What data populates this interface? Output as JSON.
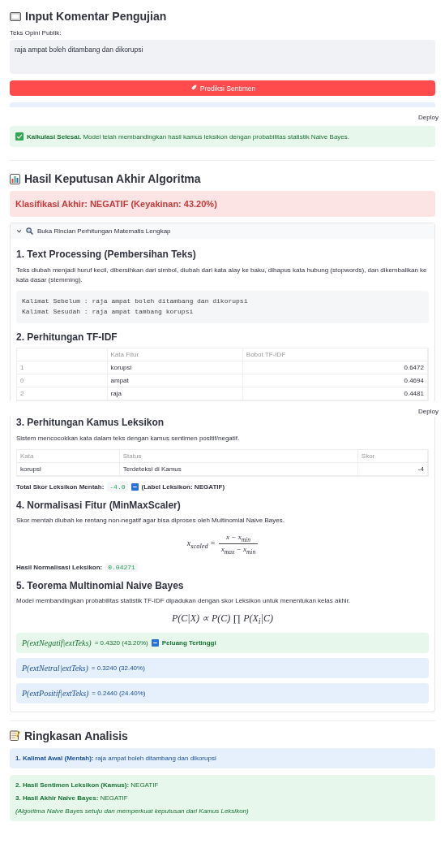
{
  "input_section": {
    "title": "Input Komentar Pengujian",
    "field_label": "Teks Opini Publik:",
    "value": "raja ampat boleh ditambang dan dikorupsi",
    "button": "Prediksi Sentimen"
  },
  "deploy": "Deploy",
  "success_message": "**Kalkulasi Selesai.** Model telah membandingkan hasil kamus leksikon dengan probabilitas statistik Naive Bayes.",
  "result": {
    "title": "Hasil Keputusan Akhir Algoritma",
    "classification": "Klasifikasi Akhir: NEGATIF (Keyakinan: 43.20%)"
  },
  "expander": {
    "label": "Buka Rincian Perhitungan Matematis Lengkap",
    "expanded": true,
    "text_processing": {
      "heading": "1. Text Processing (Pembersihan Teks)",
      "paragraph": "Teks diubah menjadi huruf kecil, dibersihkan dari simbol, diubah dari kata alay ke baku, dihapus kata hubung (stopwords), dan dikembalikan ke kata dasar (stemming).",
      "code_lines": [
        "Kalimat Sebelum : raja ampat boleh ditambang dan dikorupsi",
        "Kalimat Sesudah : raja ampat tambang korupsi"
      ]
    },
    "tfidf": {
      "heading": "2. Perhitungan TF-IDF",
      "columns": [
        "Kata Fitur",
        "Bobot TF-IDF"
      ],
      "rows": [
        {
          "index": "1",
          "word": "korupsi",
          "weight": "0.6472"
        },
        {
          "index": "0",
          "word": "ampat",
          "weight": "0.4694"
        },
        {
          "index": "2",
          "word": "raja",
          "weight": "0.4481"
        }
      ]
    },
    "deploy": "Deploy",
    "lexicon": {
      "heading": "3. Perhitungan Kamus Leksikon",
      "paragraph": "Sistem mencocokkan kata dalam teks dengan kamus sentimen positif/negatif.",
      "columns": [
        "Kata",
        "Status",
        "Skor"
      ],
      "rows": [
        {
          "word": "korupsi",
          "status": "Terdeteksi di Kamus",
          "score": "-4"
        }
      ],
      "total_label": "Total Skor Leksikon Mentah:",
      "total_value": "-4.0",
      "total_tail": "(Label Leksikon: NEGATIF)"
    },
    "normalization": {
      "heading": "4. Normalisasi Fitur (MinMaxScaler)",
      "paragraph": "Skor mentah diubah ke rentang non-negatif agar bisa diproses oleh Multinomial Naive Bayes.",
      "formula_left": "x$_{scaled}$ =",
      "formula_numerator": "x − x$_{min}$",
      "formula_denominator": "x$_{max}$ − x$_{min}$",
      "result_label": "Hasil Normalisasi Leksikon:",
      "result_value": "0.04271"
    },
    "bayes": {
      "heading": "5. Teorema Multinomial Naive Bayes",
      "paragraph": "Model membandingkan probabilitas statistik TF-IDF dipadukan dengan skor Leksikon untuk menentukan kelas akhir.",
      "formula": "P(C|X) ∝ P(C) ∏ P(X$_{i}$|C)",
      "probabilities": [
        {
          "expression": "P(extNegatif|extTeks)",
          "value": "= 0.4320 (43.20%)",
          "highest": true,
          "badge": "Peluang Tertinggi"
        },
        {
          "expression": "P(extNetral|extTeks)",
          "value": "= 0.3240 (32.40%)",
          "highest": false
        },
        {
          "expression": "P(extPositif|extTeks)",
          "value": "= 0.2440 (24.40%)",
          "highest": false
        }
      ]
    }
  },
  "summary": {
    "title": "Ringkasan Analisis",
    "boxes": [
      {
        "kind": "info",
        "lines": [
          {
            "kind": "text",
            "text": "**1. Kalimat Awal (Mentah):** raja ampat boleh ditambang dan dikorupsi"
          }
        ]
      },
      {
        "kind": "success",
        "lines": [
          {
            "kind": "text",
            "text": "**2. Hasil Sentimen Leksikon (Kamus):** NEGATIF"
          },
          {
            "kind": "text",
            "text": "**3. Hasil Akhir Naive Bayes:** NEGATIF"
          },
          {
            "kind": "note",
            "text": "(Algoritma Naive Bayes setuju dan memperkuat keputusan dari Kamus Leksikon)"
          }
        ]
      }
    ]
  }
}
